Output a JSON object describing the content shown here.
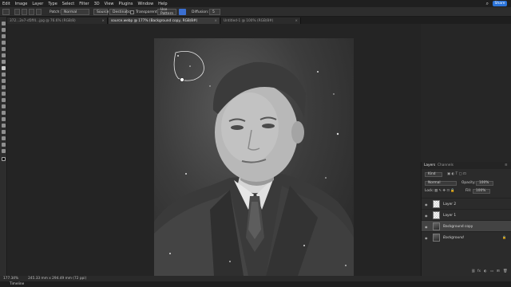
{
  "menu": [
    "Edit",
    "Image",
    "Layer",
    "Type",
    "Select",
    "Filter",
    "3D",
    "View",
    "Plugins",
    "Window",
    "Help"
  ],
  "share_label": "Share",
  "options": {
    "patch_label": "Patch:",
    "patch_value": "Normal",
    "source_label": "Source",
    "destination_label": "Destination",
    "transparent_label": "Transparent",
    "use_pattern_label": "Use Pattern",
    "diffusion_label": "Diffusion:",
    "diffusion_value": "5"
  },
  "tabs": [
    {
      "label": "372...2e7-d5ff4...jpg @ 76.6% (RGB/8)"
    },
    {
      "label": "source.webp @ 177% (Background copy, RGB/8#)"
    },
    {
      "label": "Untitled-1 @ 100% (RGB/8#)"
    }
  ],
  "layers_panel": {
    "tab_layers": "Layers",
    "tab_channels": "Channels",
    "kind_label": "Kind",
    "blend_mode": "Normal",
    "opacity_label": "Opacity:",
    "opacity_value": "100%",
    "lock_label": "Lock:",
    "fill_label": "Fill:",
    "fill_value": "100%",
    "layers": [
      {
        "name": "Layer 2"
      },
      {
        "name": "Layer 1"
      },
      {
        "name": "Background copy"
      },
      {
        "name": "Background"
      }
    ]
  },
  "status": {
    "zoom": "177.34%",
    "size": "245.33 mm x 294.49 mm (72 ppi)"
  },
  "timeline_label": "Timeline"
}
